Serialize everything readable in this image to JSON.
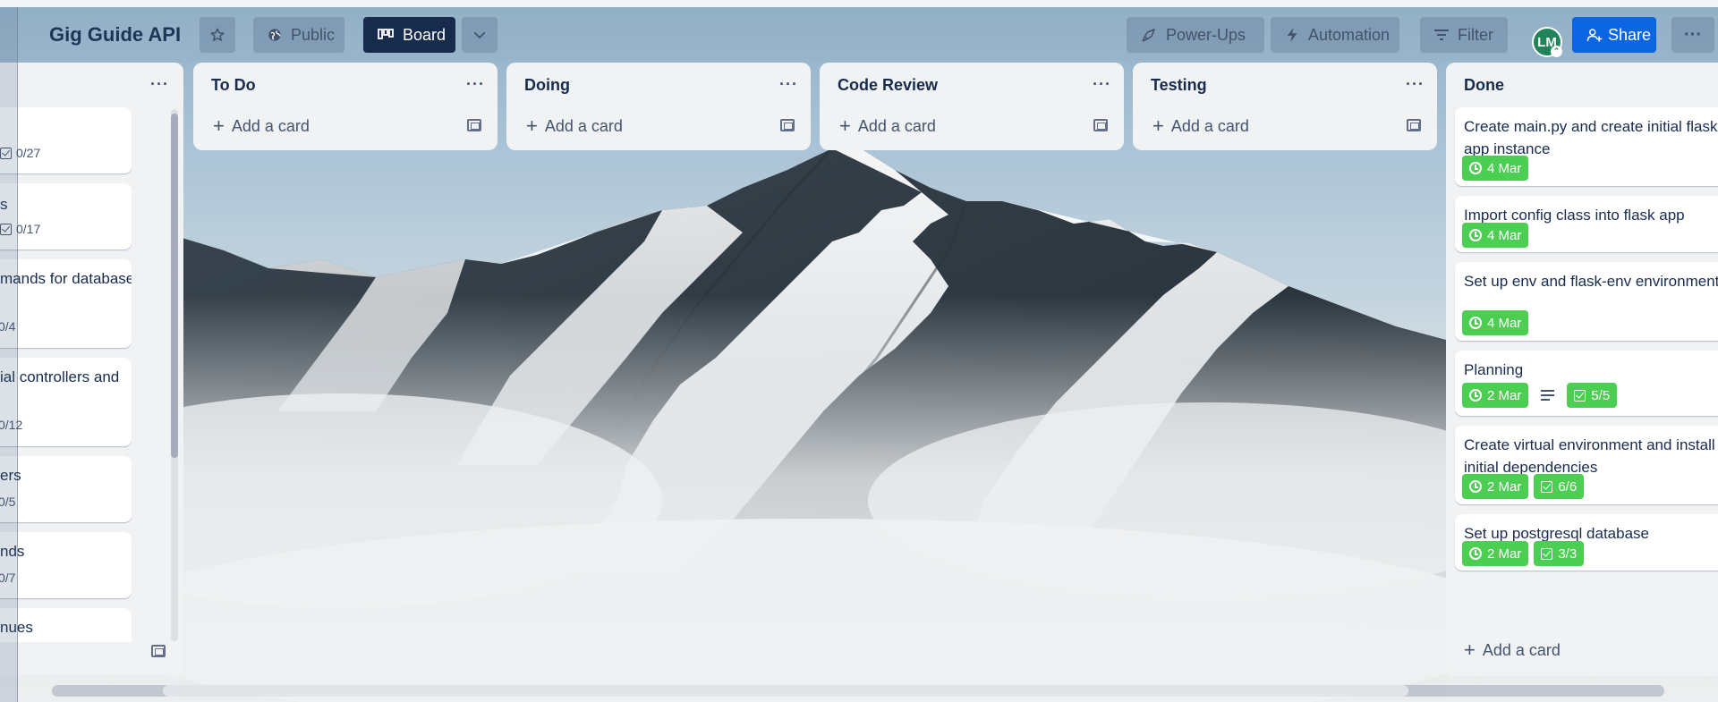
{
  "board": {
    "title": "Gig Guide API",
    "visibility_label": "Public",
    "view_label": "Board",
    "powerups_label": "Power-Ups",
    "automation_label": "Automation",
    "filter_label": "Filter",
    "share_label": "Share",
    "avatar_initials": "LM",
    "more_label": "···"
  },
  "colors": {
    "header_dark": "#172b4d",
    "share_blue": "#0c66e4",
    "avatar_green": "#1f845a",
    "due_complete_green": "#4bce52",
    "list_bg": "#f1f2f4"
  },
  "partial_list": {
    "cards": [
      {
        "title": "",
        "badge": "0/27"
      },
      {
        "title": "s",
        "badge": "0/17"
      },
      {
        "title": "mands for database",
        "badge": "0/4"
      },
      {
        "title": "ial controllers and",
        "badge": "0/12"
      },
      {
        "title": "ers",
        "badge": "0/5"
      },
      {
        "title": "nds",
        "badge": "0/7"
      },
      {
        "title": "nues",
        "badge": ""
      }
    ]
  },
  "lists": [
    {
      "name": "To Do",
      "add_label": "Add a card"
    },
    {
      "name": "Doing",
      "add_label": "Add a card"
    },
    {
      "name": "Code Review",
      "add_label": "Add a card"
    },
    {
      "name": "Testing",
      "add_label": "Add a card"
    }
  ],
  "done_list": {
    "name": "Done",
    "add_label": "Add a card",
    "cards": [
      {
        "title": "Create main.py and create initial flask app instance",
        "due": "4 Mar"
      },
      {
        "title": "Import config class into flask app",
        "due": "4 Mar"
      },
      {
        "title": "Set up env and flask-env environments",
        "due": "4 Mar"
      },
      {
        "title": "Planning",
        "due": "2 Mar",
        "checklist": "5/5"
      },
      {
        "title": "Create virtual environment and install initial dependencies",
        "due": "2 Mar",
        "checklist": "6/6"
      },
      {
        "title": "Set up postgresql database",
        "due": "2 Mar",
        "checklist": "3/3"
      }
    ]
  }
}
